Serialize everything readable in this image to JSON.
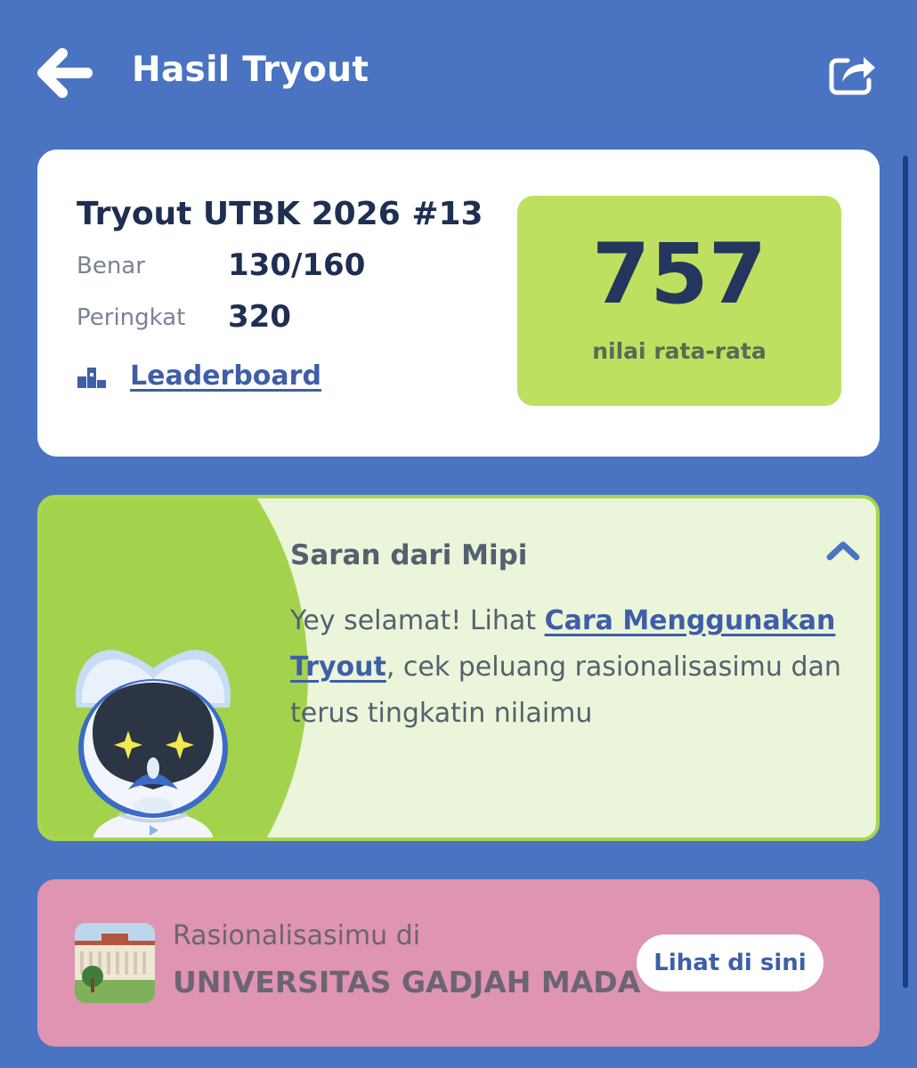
{
  "header": {
    "title": "Hasil Tryout",
    "back_icon": "arrow-left-icon",
    "share_icon": "share-icon"
  },
  "score_card": {
    "tryout_name": "Tryout UTBK 2026 #13",
    "correct_label": "Benar",
    "correct_value": "130/160",
    "rank_label": "Peringkat",
    "rank_value": "320",
    "leaderboard_label": "Leaderboard",
    "leaderboard_icon": "podium-icon",
    "score": "757",
    "score_caption": "nilai rata-rata"
  },
  "suggestion": {
    "title": "Saran dari Mipi",
    "text_before": "Yey selamat! Lihat ",
    "link_text": "Cara Menggunakan Tryout",
    "text_after": ", cek peluang rasionalisasimu dan terus tingkatin nilaimu",
    "collapse_icon": "chevron-up-icon",
    "mascot": "mipi-robot-mascot"
  },
  "rationalization": {
    "label": "Rasionalisasimu di",
    "university": "UNIVERSITAS GADJAH MADA",
    "button_label": "Lihat di sini",
    "image": "university-building-image"
  },
  "colors": {
    "background": "#4a74c2",
    "score_box": "#bedf60",
    "suggestion_bg": "#ebf5d9",
    "suggestion_border": "#a7d54e",
    "rationalization_bg": "#df94b1",
    "link": "#3e5ea8",
    "dark_text": "#1f2f52"
  }
}
